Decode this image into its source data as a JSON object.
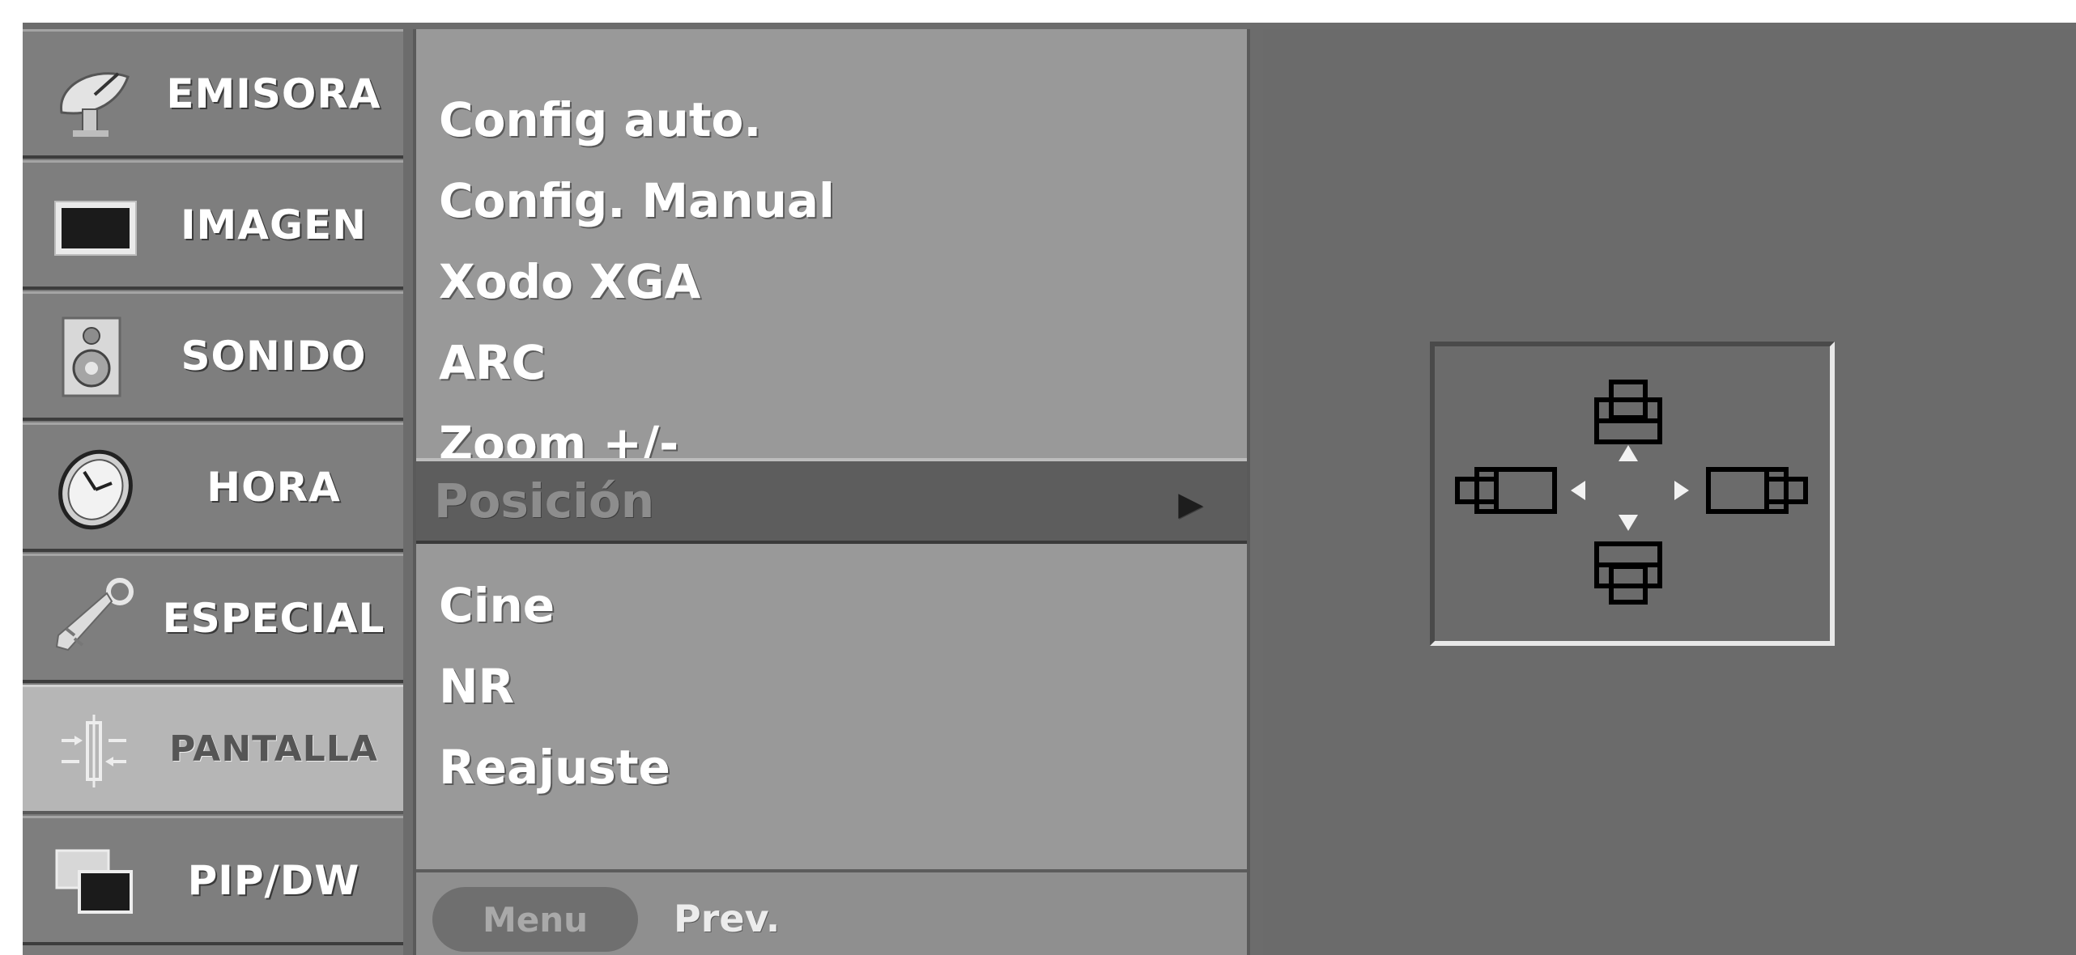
{
  "categories": [
    {
      "label": "EMISORA",
      "icon": "satellite-dish-icon"
    },
    {
      "label": "IMAGEN",
      "icon": "screen-icon"
    },
    {
      "label": "SONIDO",
      "icon": "speaker-icon"
    },
    {
      "label": "HORA",
      "icon": "clock-icon"
    },
    {
      "label": "ESPECIAL",
      "icon": "key-icon"
    },
    {
      "label": "PANTALLA",
      "icon": "screen-adjust-icon"
    },
    {
      "label": "PIP/DW",
      "icon": "pip-icon"
    }
  ],
  "active_category": "PANTALLA",
  "menu": {
    "items": [
      "Config auto.",
      "Config. Manual",
      "Xodo XGA",
      "ARC",
      "Zoom +/-",
      "Posición",
      "Cine",
      "NR",
      "Reajuste"
    ],
    "selected_item": "Posición",
    "selected_arrow": "▶"
  },
  "footer": {
    "menu_button": "Menu",
    "prev_label": "Prev."
  },
  "position_panel": {
    "icon": "position-adjust-icon",
    "arrows": [
      "▲",
      "▼",
      "◀",
      "▶"
    ]
  },
  "colors": {
    "background": "#6b6b6b",
    "menu_panel": "#999999",
    "selected_row": "#5d5d5d",
    "active_category": "#b6b6b6",
    "text": "#ffffff"
  }
}
